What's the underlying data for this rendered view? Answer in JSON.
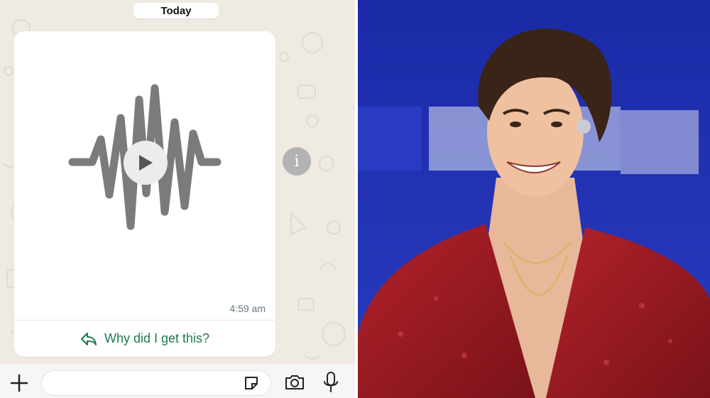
{
  "chat": {
    "date_label": "Today",
    "message": {
      "type": "voice-message",
      "time": "4:59 am",
      "link_label": "Why did I get this?"
    },
    "icons": {
      "play": "play-icon",
      "info": "info-icon",
      "reply": "reply-arrow-icon",
      "plus": "plus-icon",
      "sticker": "sticker-icon",
      "camera": "camera-icon",
      "mic": "microphone-icon"
    },
    "colors": {
      "chat_background": "#efeae2",
      "link_green": "#1f7a4a",
      "timestamp_gray": "#667781"
    }
  },
  "photo": {
    "subject": "smiling man on stage",
    "outfit_color": "#9d1b22",
    "background_color": "#1f2fa8"
  }
}
